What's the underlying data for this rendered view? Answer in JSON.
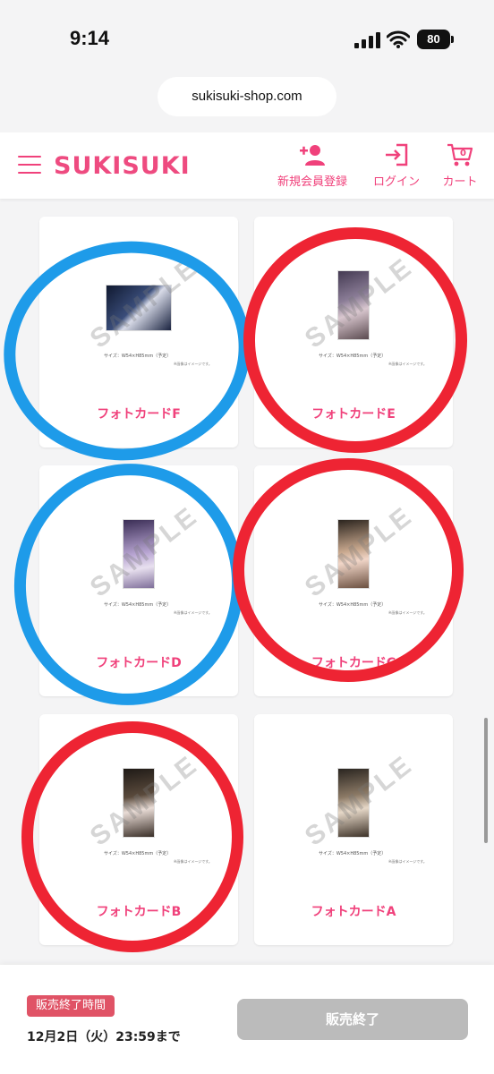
{
  "status_bar": {
    "time": "9:14",
    "battery": "80"
  },
  "browser": {
    "url": "sukisuki-shop.com"
  },
  "header": {
    "logo": "SUKISUKI",
    "register_label": "新規会員登録",
    "login_label": "ログイン",
    "cart_label": "カート",
    "cart_count": "0"
  },
  "products": [
    {
      "title": "フォトカードF",
      "sample": "SAMPLE",
      "size": "サイズ：W54×H85mm（予定）",
      "note": "※画像はイメージです。"
    },
    {
      "title": "フォトカードE",
      "sample": "SAMPLE",
      "size": "サイズ：W54×H85mm（予定）",
      "note": "※画像はイメージです。"
    },
    {
      "title": "フォトカードD",
      "sample": "SAMPLE",
      "size": "サイズ：W54×H85mm（予定）",
      "note": "※画像はイメージです。"
    },
    {
      "title": "フォトカードC",
      "sample": "SAMPLE",
      "size": "サイズ：W54×H85mm（予定）",
      "note": "※画像はイメージです。"
    },
    {
      "title": "フォトカードB",
      "sample": "SAMPLE",
      "size": "サイズ：W54×H85mm（予定）",
      "note": "※画像はイメージです。"
    },
    {
      "title": "フォトカードA",
      "sample": "SAMPLE",
      "size": "サイズ：W54×H85mm（予定）",
      "note": "※画像はイメージです。"
    }
  ],
  "annotation_colors": {
    "blue": "#1e9be9",
    "red": "#ee2433"
  },
  "footer": {
    "end_badge": "販売終了時間",
    "end_date": "12月2日（火）23:59まで",
    "button_label": "販売終了"
  },
  "colors": {
    "accent": "#f0417b",
    "badge": "#e05366",
    "disabled_button": "#bbbbbb"
  }
}
